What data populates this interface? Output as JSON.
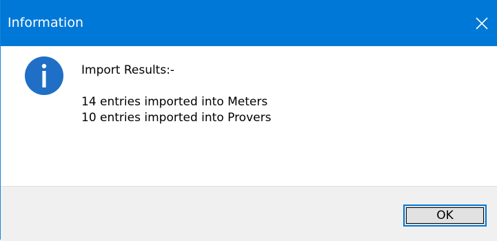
{
  "window": {
    "title": "Information",
    "close_icon": "close-icon",
    "titlebar_color": "#0078d7"
  },
  "content": {
    "icon": "info-icon",
    "icon_color": "#1f6fc6",
    "heading": "Import Results:-",
    "lines": [
      "14 entries imported into Meters",
      "10 entries imported into Provers"
    ]
  },
  "footer": {
    "ok_label": "OK"
  }
}
